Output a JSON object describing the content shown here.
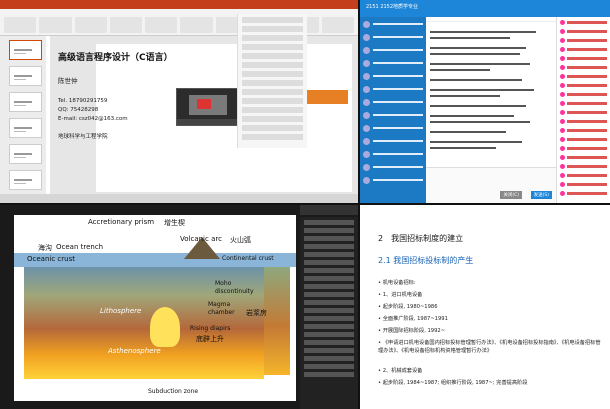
{
  "slide": {
    "title": "高级语言程序设计（C语言）",
    "instructor": "陈世仲",
    "tel": "Tel. 18790291759",
    "qq": "QQ: 75428298",
    "email": "E-mail: csz042@163.com",
    "college": "地球科学与工程学院"
  },
  "chat": {
    "group_name": "2151 2152地质学专业",
    "send_label": "发送(S)",
    "close_label": "关闭(C)"
  },
  "geology": {
    "labels": {
      "accretionary_prism": "Accretionary prism",
      "accretionary_prism_cn": "增生楔",
      "volcanic_arc": "Volcanic arc",
      "volcanic_arc_cn": "火山弧",
      "ocean_trench": "Ocean trench",
      "ocean_trench_cn": "海沟",
      "oceanic_crust": "Oceanic crust",
      "continental_crust": "Continental crust",
      "moho": "Moho discontinuity",
      "magma_chamber": "Magma chamber",
      "magma_chamber_cn": "岩浆房",
      "rising_diapirs": "Rising diapirs",
      "rising_diapirs_cn": "底辟上升",
      "lithosphere": "Lithosphere",
      "asthenosphere": "Asthenosphere",
      "subduction_zone": "Subduction zone"
    }
  },
  "doc": {
    "section": "2　我国招标制度的建立",
    "subsection": "2.1 我国招标投标制的产生",
    "items": [
      "• 机电设备招标:",
      "• 1、进口机电设备",
      "• 起步阶段, 1980~1986",
      "• 全面推广阶段, 1987~1991",
      "• 开展国际招标阶段, 1992~",
      "• 《申请进口机电设备国内招标投标管理暂行办法》、《机电设备招标投标指南》、《机电设备招标管理办法》、《机电设备招标机构资格管理暂行办法》",
      "• 2、机械成套设备",
      "• 起步阶段, 1984~1987; 组织推行阶段, 1987~; 完善提高阶段"
    ]
  }
}
